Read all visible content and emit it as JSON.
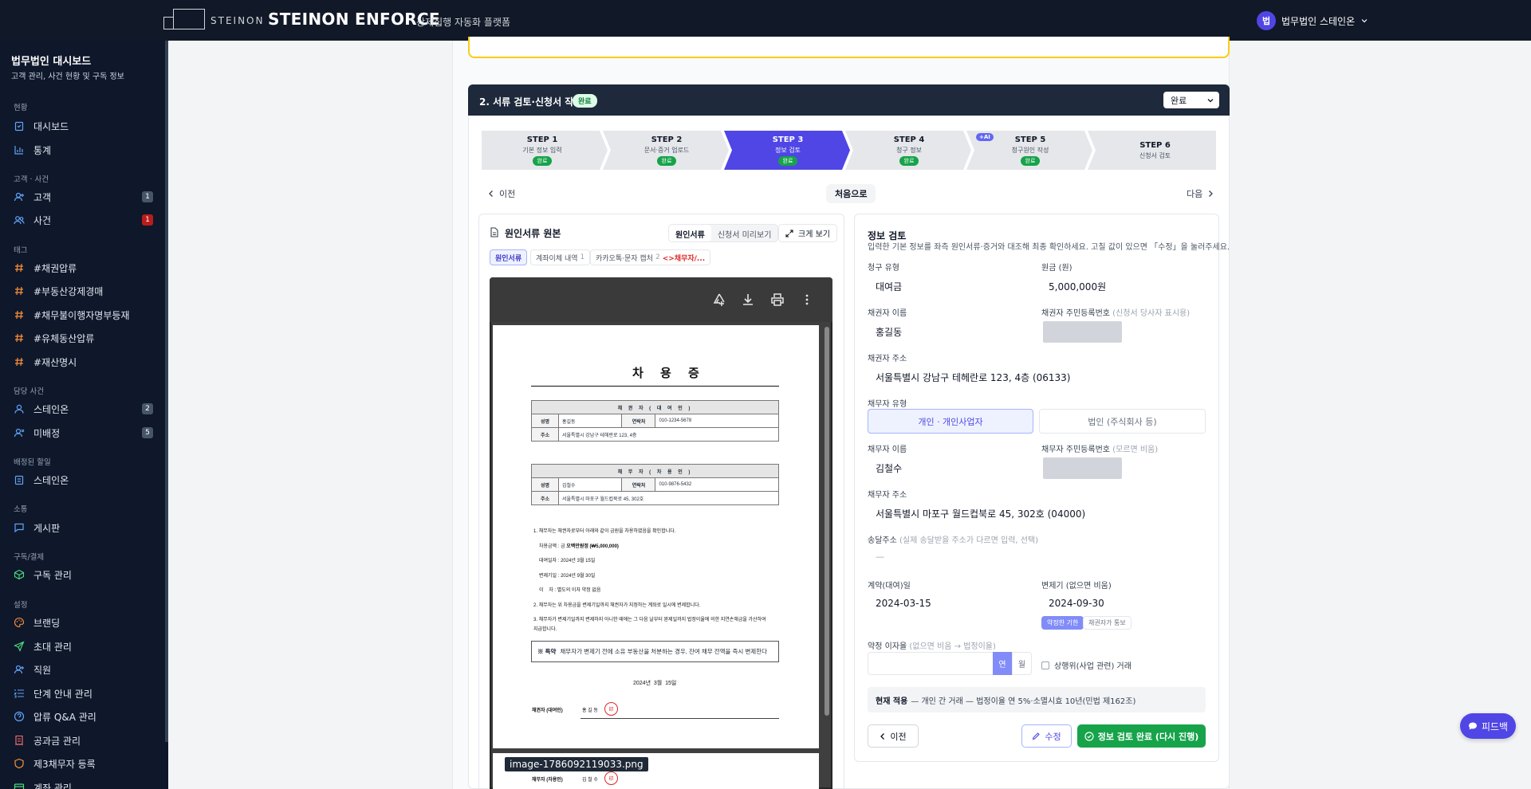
{
  "topbar": {
    "logo_text": "STEINON",
    "brand": "STEINON ENFORCE",
    "brand_sub": "강제집행 자동화 플랫폼",
    "user_initial": "법",
    "user_name": "법무법인 스테인온"
  },
  "sidebar": {
    "title": "법무법인 대시보드",
    "subtitle": "고객 관리, 사건 현황 및 구독 정보",
    "sections": {
      "status": "현황",
      "client_case": "고객 · 사건",
      "tags": "태그",
      "assigned": "담당 사건",
      "assigned_todo": "배정된 할일",
      "comm": "소통",
      "billing": "구독/결제",
      "settings": "설정"
    },
    "items": {
      "dashboard": "대시보드",
      "stats": "통계",
      "clients": "고객",
      "clients_count": "1",
      "cases": "사건",
      "cases_count": "1",
      "tag1": "#채권압류",
      "tag2": "#부동산강제경매",
      "tag3": "#채무불이행자명부등재",
      "tag4": "#유체동산압류",
      "tag5": "#재산명시",
      "steinon": "스테인온",
      "steinon_count": "2",
      "unassigned": "미배정",
      "unassigned_count": "5",
      "todo_steinon": "스테인온",
      "board": "게시판",
      "subscription": "구독 관리",
      "branding": "브랜딩",
      "invite": "초대 관리",
      "staff": "직원",
      "steps_guide": "단계 안내 관리",
      "qa": "압류 Q&A 관리",
      "public_fee": "공과금 관리",
      "third_party": "제3채무자 등록",
      "account": "계좌 관리"
    }
  },
  "card": {
    "title": "2. 서류 검토·신청서 작성",
    "badge": "완료",
    "status_value": "완료"
  },
  "steps": [
    {
      "label": "STEP 1",
      "desc": "기본 정보 입력",
      "badge": "완료"
    },
    {
      "label": "STEP 2",
      "desc": "문서·증거 업로드",
      "badge": "완료"
    },
    {
      "label": "STEP 3",
      "desc": "정보 검토",
      "badge": "완료"
    },
    {
      "label": "STEP 4",
      "desc": "청구 정보",
      "badge": "완료"
    },
    {
      "label": "STEP 5",
      "desc": "청구원인 작성",
      "badge": "완료",
      "tag": "+AI"
    },
    {
      "label": "STEP 6",
      "desc": "신청서 검토",
      "badge": ""
    }
  ],
  "step_nav": {
    "prev": "이전",
    "first": "처음으로",
    "next": "다음"
  },
  "doc": {
    "title": "원인서류 원본",
    "tab_original": "원인서류",
    "tab_preview": "신청서 미리보기",
    "expand": "크게 보기",
    "chips": {
      "c1": "원인서류",
      "c2": "계좌이체 내역",
      "c2_count": "1",
      "c3": "카카오톡·문자 캡처",
      "c3_count": "2",
      "c3_extra": "<>채무자/..."
    },
    "image_label": "image-1786092119033.png"
  },
  "contract": {
    "title": "차 용 증",
    "creditor_header": "채 권 자 ( 대 여 인 )",
    "debtor_header": "채 무 자 ( 차 용 인 )",
    "name_label": "성명",
    "phone_label": "연락처",
    "addr_label": "주소",
    "creditor_name": "홍길동",
    "creditor_phone": "010-1234-5678",
    "creditor_addr": "서울특별시 강남구 테헤란로 123, 4층",
    "debtor_name": "김철수",
    "debtor_phone": "010-9876-5432",
    "debtor_addr": "서울특별시 마포구 월드컵북로 45, 302호",
    "p1": "1. 채무자는 채권자로부터 아래와 같이 금원을 차용하였음을 확인합니다.",
    "l_amount_label": "차용금액 : 금",
    "l_amount_value": "오백만원정 (₩5,000,000)",
    "l_loan_date": "대여일자 : 2024년 3월 15일",
    "l_due_date": "변제기일 : 2024년 9월 30일",
    "l_interest": "이    자 : 별도의 이자 약정 없음",
    "p2": "2. 채무자는 위 차용금을 변제기일까지 채권자가 지정하는 계좌로 일시에 변제합니다.",
    "p3": "3. 채무자가 변제기일까지 변제하지 아니한 때에는 그 다음 날부터 완제일까지 법정이율에 의한 지연손해금을 가산하여",
    "p3b": "지급합니다.",
    "special_label": "※ 특약",
    "special_text": "채무자가 변제기 전에 소유 부동산을 처분하는 경우, 잔여 채무 전액을 즉시 변제한다",
    "date": "2024년  3월  15일",
    "sign_creditor_label": "채권자 (대여인)",
    "sign_creditor_name": "홍 길 동",
    "sign_debtor_label": "채무자 (차용인)",
    "sign_debtor_name": "김 철 수",
    "seal_text": "印"
  },
  "info": {
    "title": "정보 검토",
    "desc": "입력한 기본 정보를 좌측 원인서류·증거와 대조해 최종 확인하세요. 고칠 값이 있으면 「수정」을 눌러주세요.",
    "claim_type_label": "청구 유형",
    "claim_type": "대여금",
    "principal_label": "원금 (원)",
    "principal": "5,000,000원",
    "creditor_name_label": "채권자 이름",
    "creditor_name": "홍길동",
    "creditor_rrn_label": "채권자 주민등록번호",
    "creditor_rrn_hint": "(신청서 당사자 표시용)",
    "creditor_addr_label": "채권자 주소",
    "creditor_addr": "서울특별시 강남구 테헤란로 123, 4층 (06133)",
    "debtor_type_label": "채무자 유형",
    "debtor_type_individual": "개인 · 개인사업자",
    "debtor_type_corp": "법인 (주식회사 등)",
    "debtor_name_label": "채무자 이름",
    "debtor_name": "김철수",
    "debtor_rrn_label": "채무자 주민등록번호",
    "debtor_rrn_hint": "(모르면 비움)",
    "debtor_addr_label": "채무자 주소",
    "debtor_addr": "서울특별시 마포구 월드컵북로 45, 302호 (04000)",
    "delivery_label": "송달주소",
    "delivery_hint": "(실제 송달받을 주소가 다르면 입력, 선택)",
    "delivery_value": "—",
    "contract_date_label": "계약(대여)일",
    "contract_date": "2024-03-15",
    "due_label": "변제기 (없으면 비움)",
    "due_date": "2024-09-30",
    "due_opt_a": "약정한 기한",
    "due_opt_b": "채권자가 통보",
    "rate_label": "약정 이자율",
    "rate_hint": "(없으면 비움 → 법정이율)",
    "rate_year": "연",
    "rate_month": "월",
    "merchant_label": "상행위(사업 관련) 거래",
    "notice_bold": "현재 적용",
    "notice_text": "— 개인 간 거래 — 법정이율 연 5%·소멸시효 10년(민법 제162조)",
    "btn_prev": "이전",
    "btn_edit": "수정",
    "btn_done": "정보 검토 완료 (다시 진행)"
  },
  "feedback": "피드백"
}
